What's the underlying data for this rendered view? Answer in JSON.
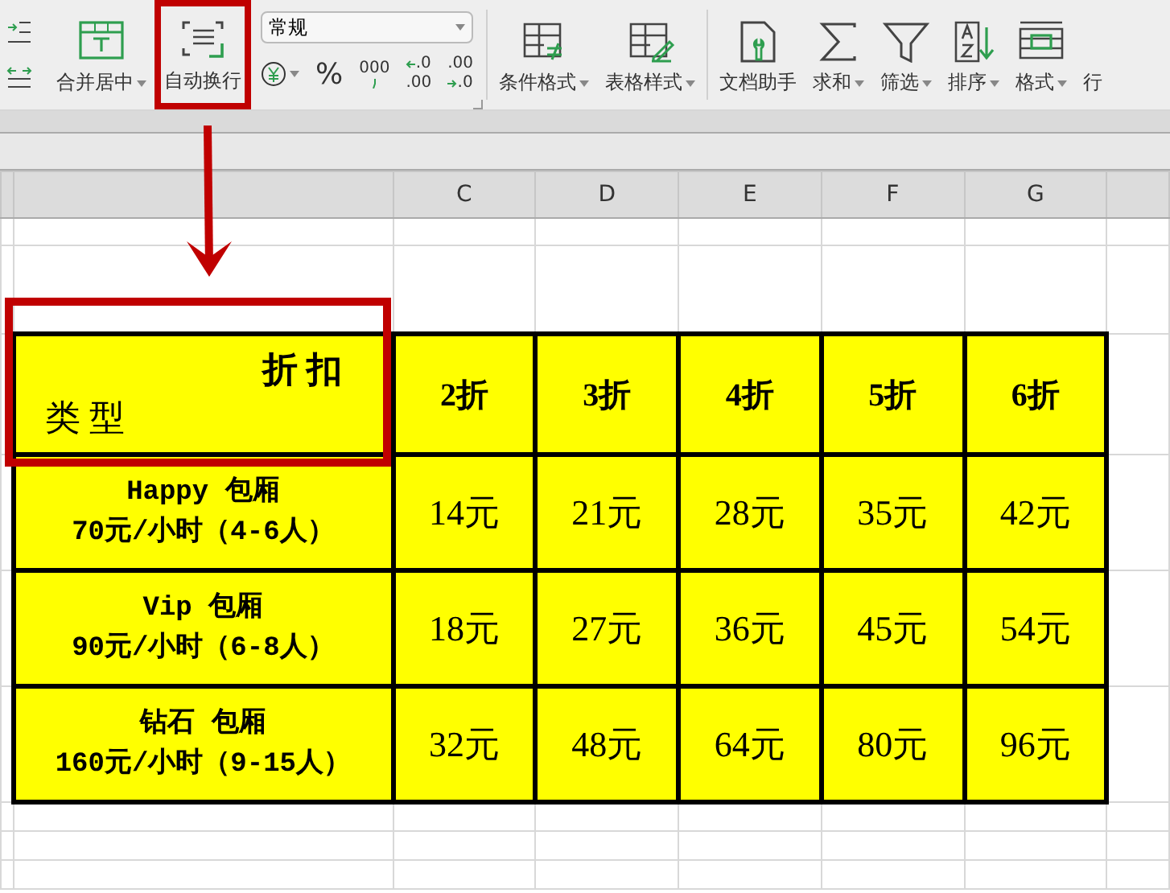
{
  "toolbar": {
    "align_buttons": [
      {
        "kind": "indent"
      },
      {
        "kind": "spread"
      }
    ],
    "buttons": [
      {
        "label": "合并居中",
        "kind": "merge",
        "dropdown": true,
        "highlighted": false
      },
      {
        "label": "自动换行",
        "kind": "wrap",
        "dropdown": false,
        "highlighted": true
      }
    ],
    "number_format": {
      "value": "常规"
    },
    "number_buttons": [
      {
        "kind": "currency",
        "dropdown": true
      },
      {
        "kind": "text",
        "text": "%"
      },
      {
        "kind": "thousands",
        "text": "000"
      },
      {
        "kind": "decimal_more",
        "lines": [
          ".0",
          ".00"
        ]
      },
      {
        "kind": "decimal_less",
        "lines": [
          ".00",
          ".0"
        ]
      }
    ],
    "style_buttons": [
      {
        "label": "条件格式",
        "kind": "conditional",
        "dropdown": true
      },
      {
        "label": "表格样式",
        "kind": "table_style",
        "dropdown": true
      }
    ],
    "data_buttons": [
      {
        "label": "文档助手",
        "kind": "doc_helper",
        "dropdown": false
      },
      {
        "label": "求和",
        "kind": "sum",
        "dropdown": true
      },
      {
        "label": "筛选",
        "kind": "filter",
        "dropdown": true
      },
      {
        "label": "排序",
        "kind": "sort",
        "dropdown": true
      },
      {
        "label": "格式",
        "kind": "format",
        "dropdown": true
      },
      {
        "label": "行",
        "kind": "none",
        "dropdown": false
      }
    ]
  },
  "sheet": {
    "columns": [
      "",
      "C",
      "D",
      "E",
      "F",
      "G"
    ],
    "table": {
      "corner_top": "折 扣",
      "corner_bottom": "类 型",
      "corner_highlighted": true,
      "discounts": [
        "2折",
        "3折",
        "4折",
        "5折",
        "6折"
      ],
      "rows": [
        {
          "name": "Happy 包厢",
          "rate": "70元/小时（4-6人）",
          "prices": [
            "14元",
            "21元",
            "28元",
            "35元",
            "42元"
          ]
        },
        {
          "name": "Vip 包厢",
          "rate": "90元/小时（6-8人）",
          "prices": [
            "18元",
            "27元",
            "36元",
            "45元",
            "54元"
          ]
        },
        {
          "name": "钻石 包厢",
          "rate": "160元/小时（9-15人）",
          "prices": [
            "32元",
            "48元",
            "64元",
            "80元",
            "96元"
          ]
        }
      ]
    }
  },
  "callout_arrow": true
}
